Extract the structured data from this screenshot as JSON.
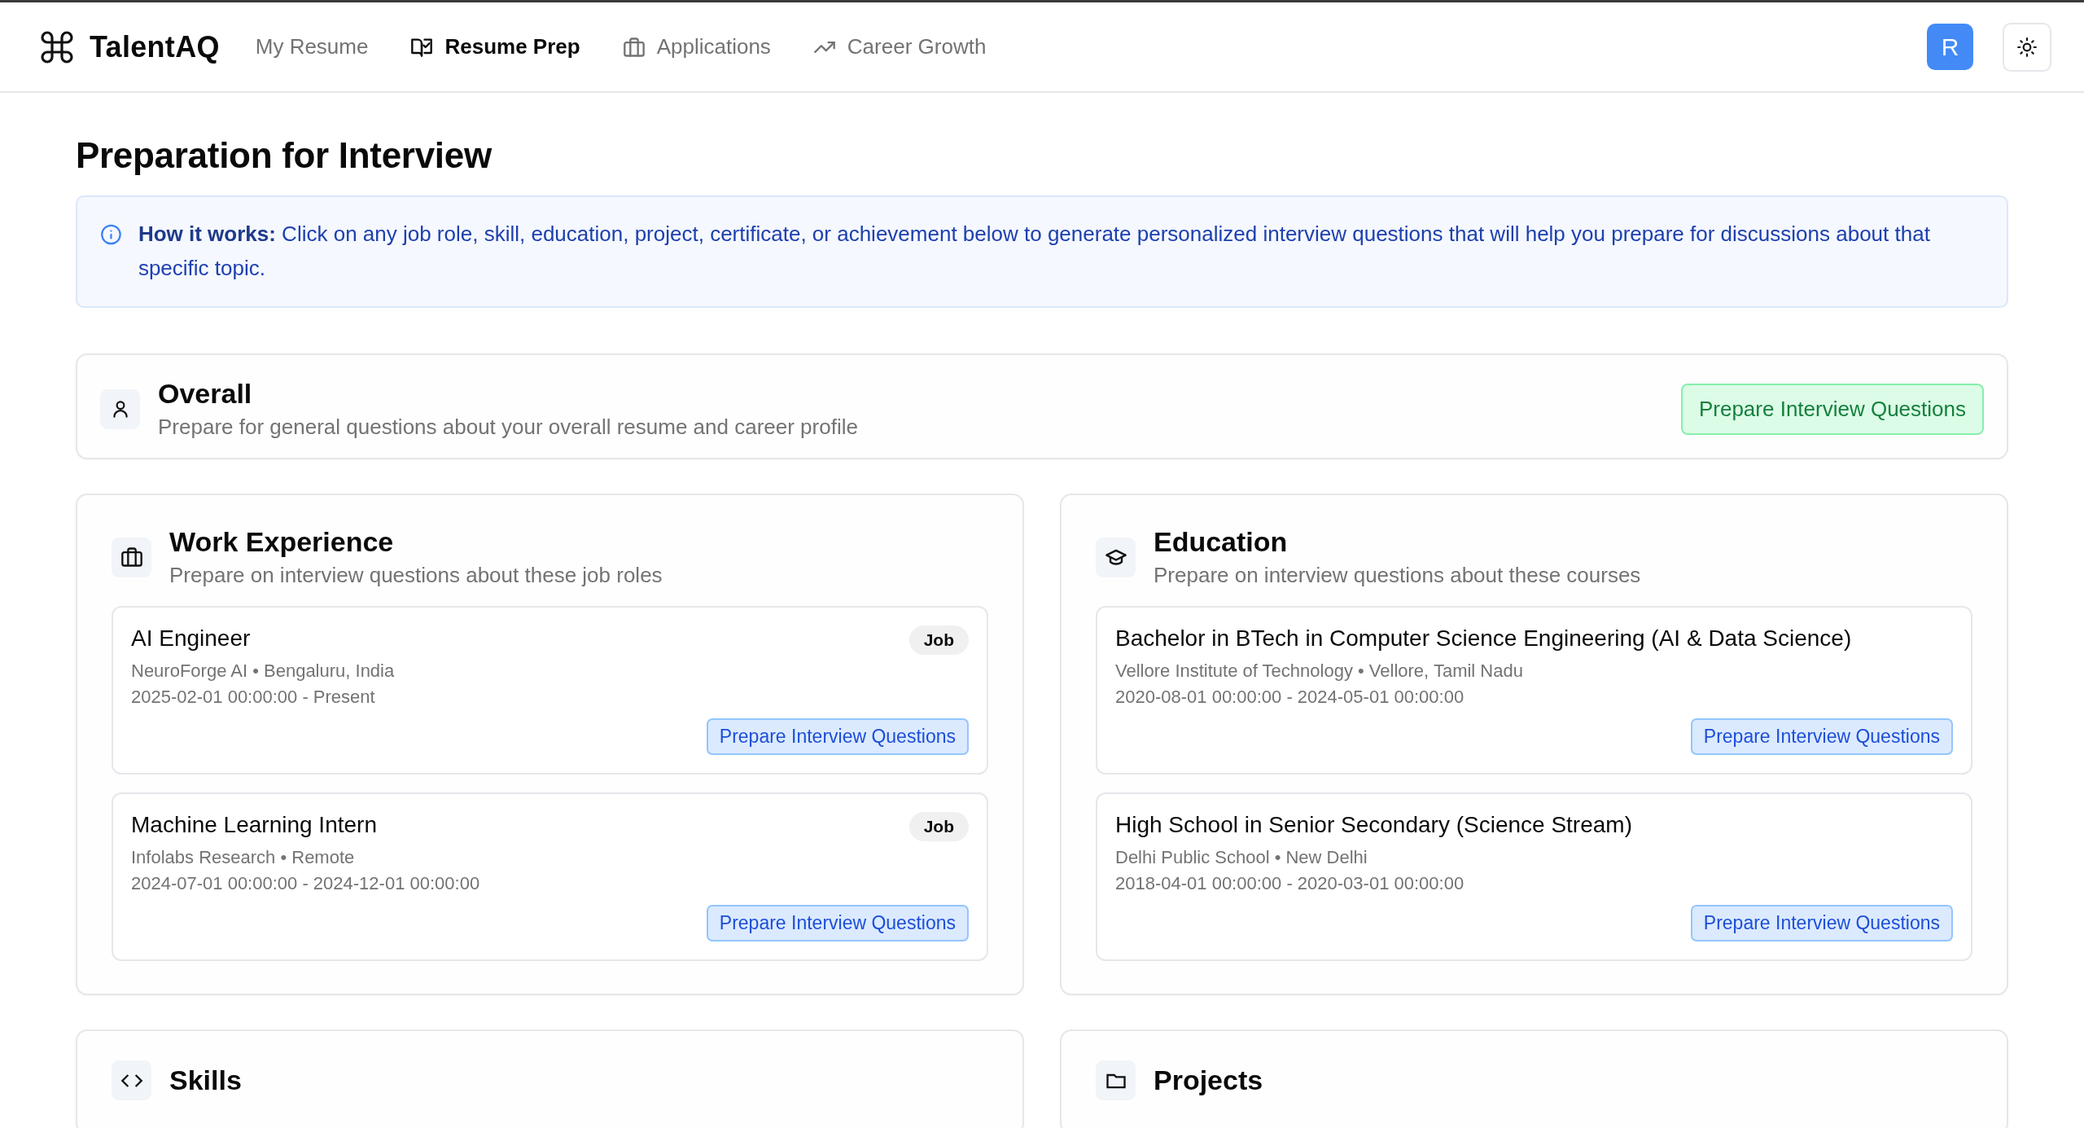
{
  "header": {
    "logo": "TalentAQ",
    "nav": [
      {
        "label": "My Resume",
        "selected": false
      },
      {
        "label": "Resume Prep",
        "selected": true
      },
      {
        "label": "Applications",
        "selected": false
      },
      {
        "label": "Career Growth",
        "selected": false
      }
    ],
    "avatar": "R"
  },
  "page_title": "Preparation for Interview",
  "info": "**How it works:** Click on any job role, skill, education, project, certificate, or achievement below to generate personalized interview questions that will help you prepare for discussions about that specific topic.",
  "overall": {
    "title": "Overall",
    "subtitle": "Prepare for general questions about your overall resume and career profile",
    "button": "Prepare Interview Questions"
  },
  "sections": [
    {
      "title": "Work Experience",
      "subtitle": "Prepare on interview questions about these job roles",
      "items": [
        {
          "title": "AI Engineer",
          "meta": "NeuroForge AI • Bengaluru, India",
          "dates": "2025-02-01 00:00:00 - Present",
          "badge": "Job",
          "button": "Prepare Interview Questions"
        },
        {
          "title": "Machine Learning Intern",
          "meta": "Infolabs Research • Remote",
          "dates": "2024-07-01 00:00:00 - 2024-12-01 00:00:00",
          "badge": "Job",
          "button": "Prepare Interview Questions"
        }
      ]
    },
    {
      "title": "Education",
      "subtitle": "Prepare on interview questions about these courses",
      "items": [
        {
          "title": "Bachelor in BTech in Computer Science Engineering (AI & Data Science)",
          "meta": "Vellore Institute of Technology • Vellore, Tamil Nadu",
          "dates": "2020-08-01 00:00:00 - 2024-05-01 00:00:00",
          "button": "Prepare Interview Questions"
        },
        {
          "title": "High School in Senior Secondary (Science Stream)",
          "meta": "Delhi Public School • New Delhi",
          "dates": "2018-04-01 00:00:00 - 2020-03-01 00:00:00",
          "button": "Prepare Interview Questions"
        }
      ]
    },
    {
      "title": "Skills"
    },
    {
      "title": "Projects"
    }
  ]
}
